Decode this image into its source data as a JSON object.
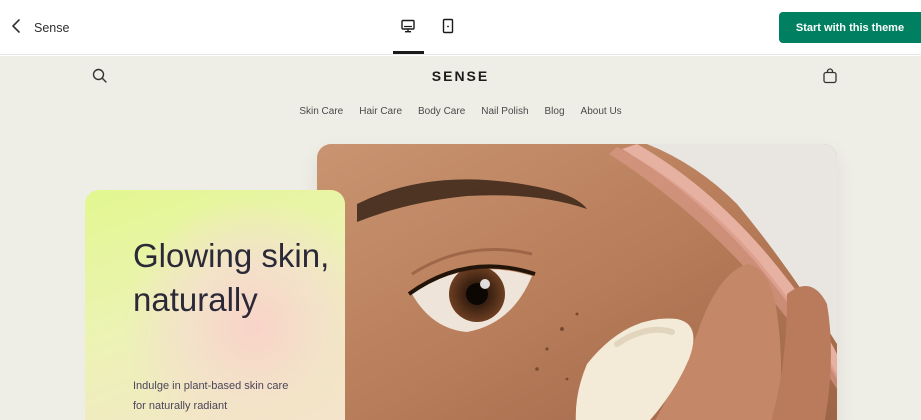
{
  "editor": {
    "back_label": "Sense",
    "cta_label": "Start with this theme",
    "devices": {
      "active": "desktop"
    }
  },
  "store": {
    "logo": "SENSE",
    "nav": [
      "Skin Care",
      "Hair Care",
      "Body Care",
      "Nail Polish",
      "Blog",
      "About Us"
    ],
    "hero": {
      "title": "Glowing skin, naturally",
      "subtitle": "Indulge in plant-based skin care for naturally radiant"
    }
  },
  "colors": {
    "accent": "#008060",
    "preview_bg": "#efeee6",
    "card_green": "#e2f78f",
    "card_pink": "#f9d3c8",
    "title_text": "#2b2937"
  },
  "icons": [
    "chevron-left-icon",
    "desktop-icon",
    "mobile-icon",
    "search-icon",
    "cart-icon"
  ]
}
